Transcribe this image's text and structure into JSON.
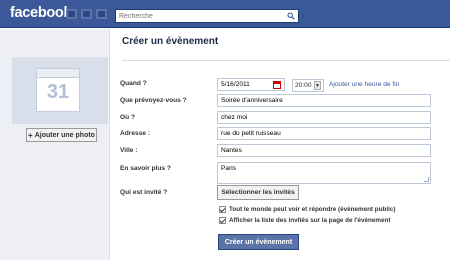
{
  "topbar": {
    "logo": "facebook",
    "search_placeholder": "Recherche"
  },
  "sidebar": {
    "calendar_day": "31",
    "add_photo_label": "Ajouter une photo"
  },
  "page": {
    "title": "Créer un évènement"
  },
  "form": {
    "when_label": "Quand ?",
    "date_value": "5/16/2011",
    "time_value": "20:00",
    "add_end_time_link": "Ajouter une heure de fin",
    "what_label": "Que prévoyez-vous ?",
    "what_value": "Soirée d'anniversaire",
    "where_label": "Où ?",
    "where_value": "chez moi",
    "address_label": "Adresse :",
    "address_value": "rue du petit ruisseau",
    "city_label": "Ville :",
    "city_value": "Nantes",
    "more_info_label": "En savoir plus ?",
    "more_info_value": "Paris",
    "invited_label": "Qui est invité ?",
    "select_guests_button": "Sélectionner les invités",
    "public_checkbox_label": "Tout le monde peut voir et répondre (évènement public)",
    "show_guest_list_label": "Afficher la liste des invités sur la page de l'évènement",
    "create_button": "Créer un évènement"
  },
  "colors": {
    "topbar": "#3b5998",
    "link": "#3b5998",
    "primary_button": "#5b74a8"
  }
}
